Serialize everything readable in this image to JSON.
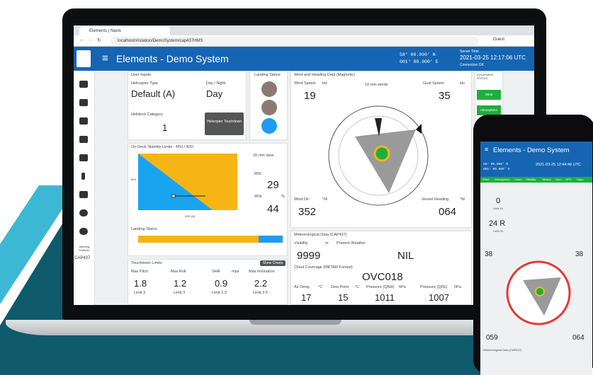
{
  "browser": {
    "tab_title": "Elements | Navis",
    "url": "localhost/#/station/DemoSystem/cap437HMS",
    "profile": "Guest"
  },
  "app": {
    "title": "Elements - Demo System",
    "lat": "58° 00.000' N",
    "lon": "001° 00.000' E",
    "server_time_label": "Server Time",
    "server_time": "2021-03-25 12:17:06 UTC",
    "connection": "Connection OK"
  },
  "sidebar": {
    "warning_label": "Warning Scheme:",
    "warning_value": "CAP437"
  },
  "user_inputs": {
    "title": "User Inputs",
    "helicopter_label": "Helicopter Type",
    "helicopter_value": "Default (A)",
    "daynight_label": "Day / Night",
    "daynight_value": "Day",
    "helideck_label": "Helideck Category",
    "helideck_value": "1",
    "touchdown_button": "Helicopter Touchdown"
  },
  "landing_status": {
    "title": "Landing Status"
  },
  "stability": {
    "title": "On-Deck Stability Limits - MSI / WSI",
    "view": "20-min view",
    "msi_label": "MSI",
    "msi_value": "29",
    "wsi_label": "WSI",
    "wsi_unit": "%",
    "wsi_value": "44",
    "x_axis_label": "WSI (N)",
    "y_axis_label": "MSI",
    "landing_status_label": "Landing Status"
  },
  "touchdown": {
    "title": "Touchdown Limits",
    "show_charts": "Show Charts",
    "pitch_label": "Max Pitch",
    "pitch_value": "1.8",
    "pitch_limit": "Limit 3",
    "roll_label": "Max Roll",
    "roll_value": "1.2",
    "roll_limit": "Limit 3",
    "shr_label": "SHR",
    "shr_unit": "mps",
    "shr_value": "0.9",
    "shr_limit": "Limit 1.3",
    "incl_label": "Max Inclination",
    "incl_value": "2.2",
    "incl_limit": "Limit 3.5"
  },
  "wind": {
    "title": "Wind and Heading Data (Magnetic)",
    "speed_label": "Wind Speed",
    "speed_unit": "kts",
    "speed_value": "19",
    "avg": "10-min winds",
    "gust_label": "Gust Speed",
    "gust_unit": "kts",
    "gust_value": "35",
    "dir_label": "Wind Dir.",
    "dir_unit": "°M",
    "dir_value": "352",
    "heading_label": "Vessel Heading",
    "heading_unit": "°M",
    "heading_value": "064"
  },
  "met": {
    "title": "Meteorological Data (CAP437)",
    "vis_label": "Visibility",
    "vis_unit": "m",
    "vis_value": "9999",
    "weather_label": "Present Weather",
    "weather_value": "NIL",
    "cloud_label": "Cloud Coverage (METAR Format)",
    "cloud_value": "OVC018",
    "air_label": "Air Temp.",
    "air_unit": "°C",
    "air_value": "17",
    "dew_label": "Dew Point",
    "dew_unit": "°C",
    "dew_value": "15",
    "qnh_label": "Pressure (QNH)",
    "qnh_unit": "hPa",
    "qnh_value": "1011",
    "qfe_label": "Pressure (QFE)",
    "qfe_unit": "hPa",
    "qfe_value": "1007"
  },
  "equipment": {
    "title": "EQUIPMENT STATUS",
    "items": [
      "Wind",
      "Atmosphere"
    ]
  },
  "phone": {
    "title": "Elements - Demo System",
    "server_time": "2021-03-25 12:44:46 UTC",
    "tabs": [
      "Wind",
      "Atmosphere",
      "Cloud",
      "Visibility",
      "Motion",
      "Gyro",
      "GPS",
      "Ospc"
    ],
    "heave_value": "0",
    "heave_limit": "Limit 10",
    "wdir_value": "24 R",
    "wdir_limit": "Limit 30",
    "wind_speed": "38",
    "gust_speed": "38",
    "wind_dir": "059",
    "heading": "064",
    "met_title": "Meteorological Data (CAP437)"
  }
}
